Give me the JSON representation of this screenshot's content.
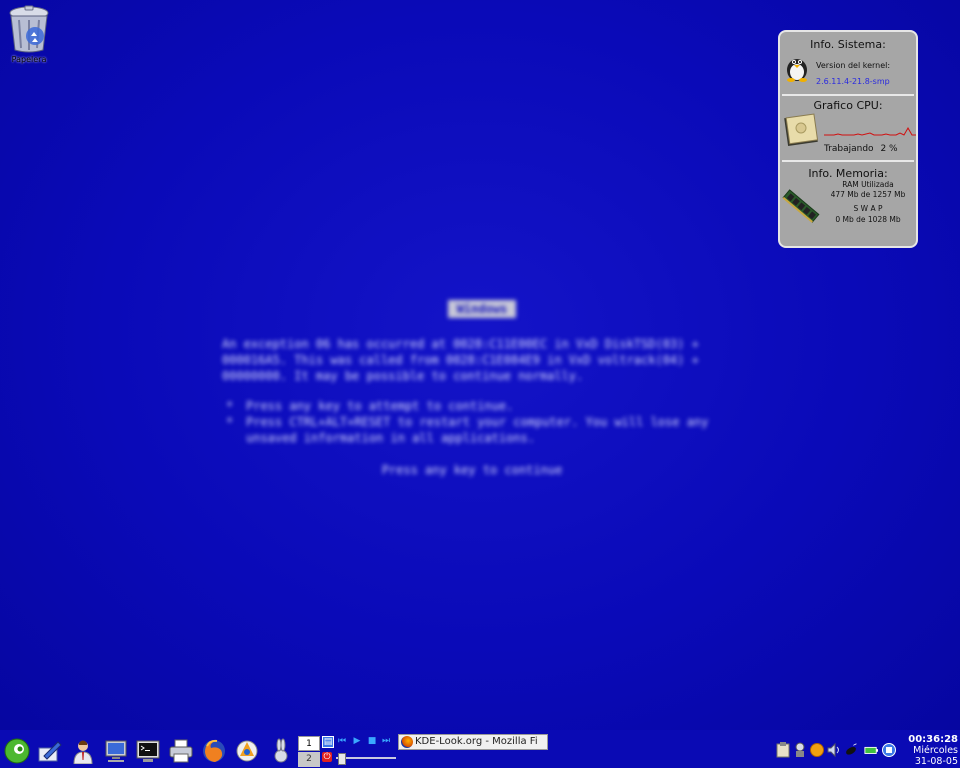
{
  "desktop": {
    "trash_label": "Papelera"
  },
  "bsod": {
    "title": "Windows",
    "paragraph": "An exception 06 has occurred at 0028:C11E00EC in VxD DiskTSD(03) + 000016A5. This was called from 0028:C1E084E9 in VxD voltrack(04) + 00000000. It may be possible to continue normally.",
    "bullets": [
      "Press any key to attempt to continue.",
      "Press CTRL+ALT+RESET to restart your computer. You will lose any unsaved information in all applications."
    ],
    "continue_text": "Press any key to continue"
  },
  "widget": {
    "system": {
      "title": "Info. Sistema:",
      "kernel_label": "Version del kernel:",
      "kernel_version": "2.6.11.4-21.8-smp"
    },
    "cpu": {
      "title": "Grafico CPU:",
      "status_label": "Trabajando",
      "usage": "2 %"
    },
    "memory": {
      "title": "Info. Memoria:",
      "ram_label": "RAM Utilizada",
      "ram_value": "477 Mb de 1257 Mb",
      "swap_label": "S W A P",
      "swap_value": "0 Mb de 1028 Mb"
    }
  },
  "taskbar": {
    "quick_launch": [
      "kmenu-icon",
      "editor-icon",
      "user-icon",
      "computer-icon",
      "terminal-icon",
      "printer-icon",
      "firefox-icon",
      "kde-icon",
      "rabbit-icon"
    ],
    "pager": {
      "desk1": "1",
      "desk2": "2"
    },
    "task_title": "KDE-Look.org - Mozilla Fi",
    "clock": {
      "time": "00:36:28",
      "day": "Miércoles",
      "date": "31-08-05"
    }
  }
}
